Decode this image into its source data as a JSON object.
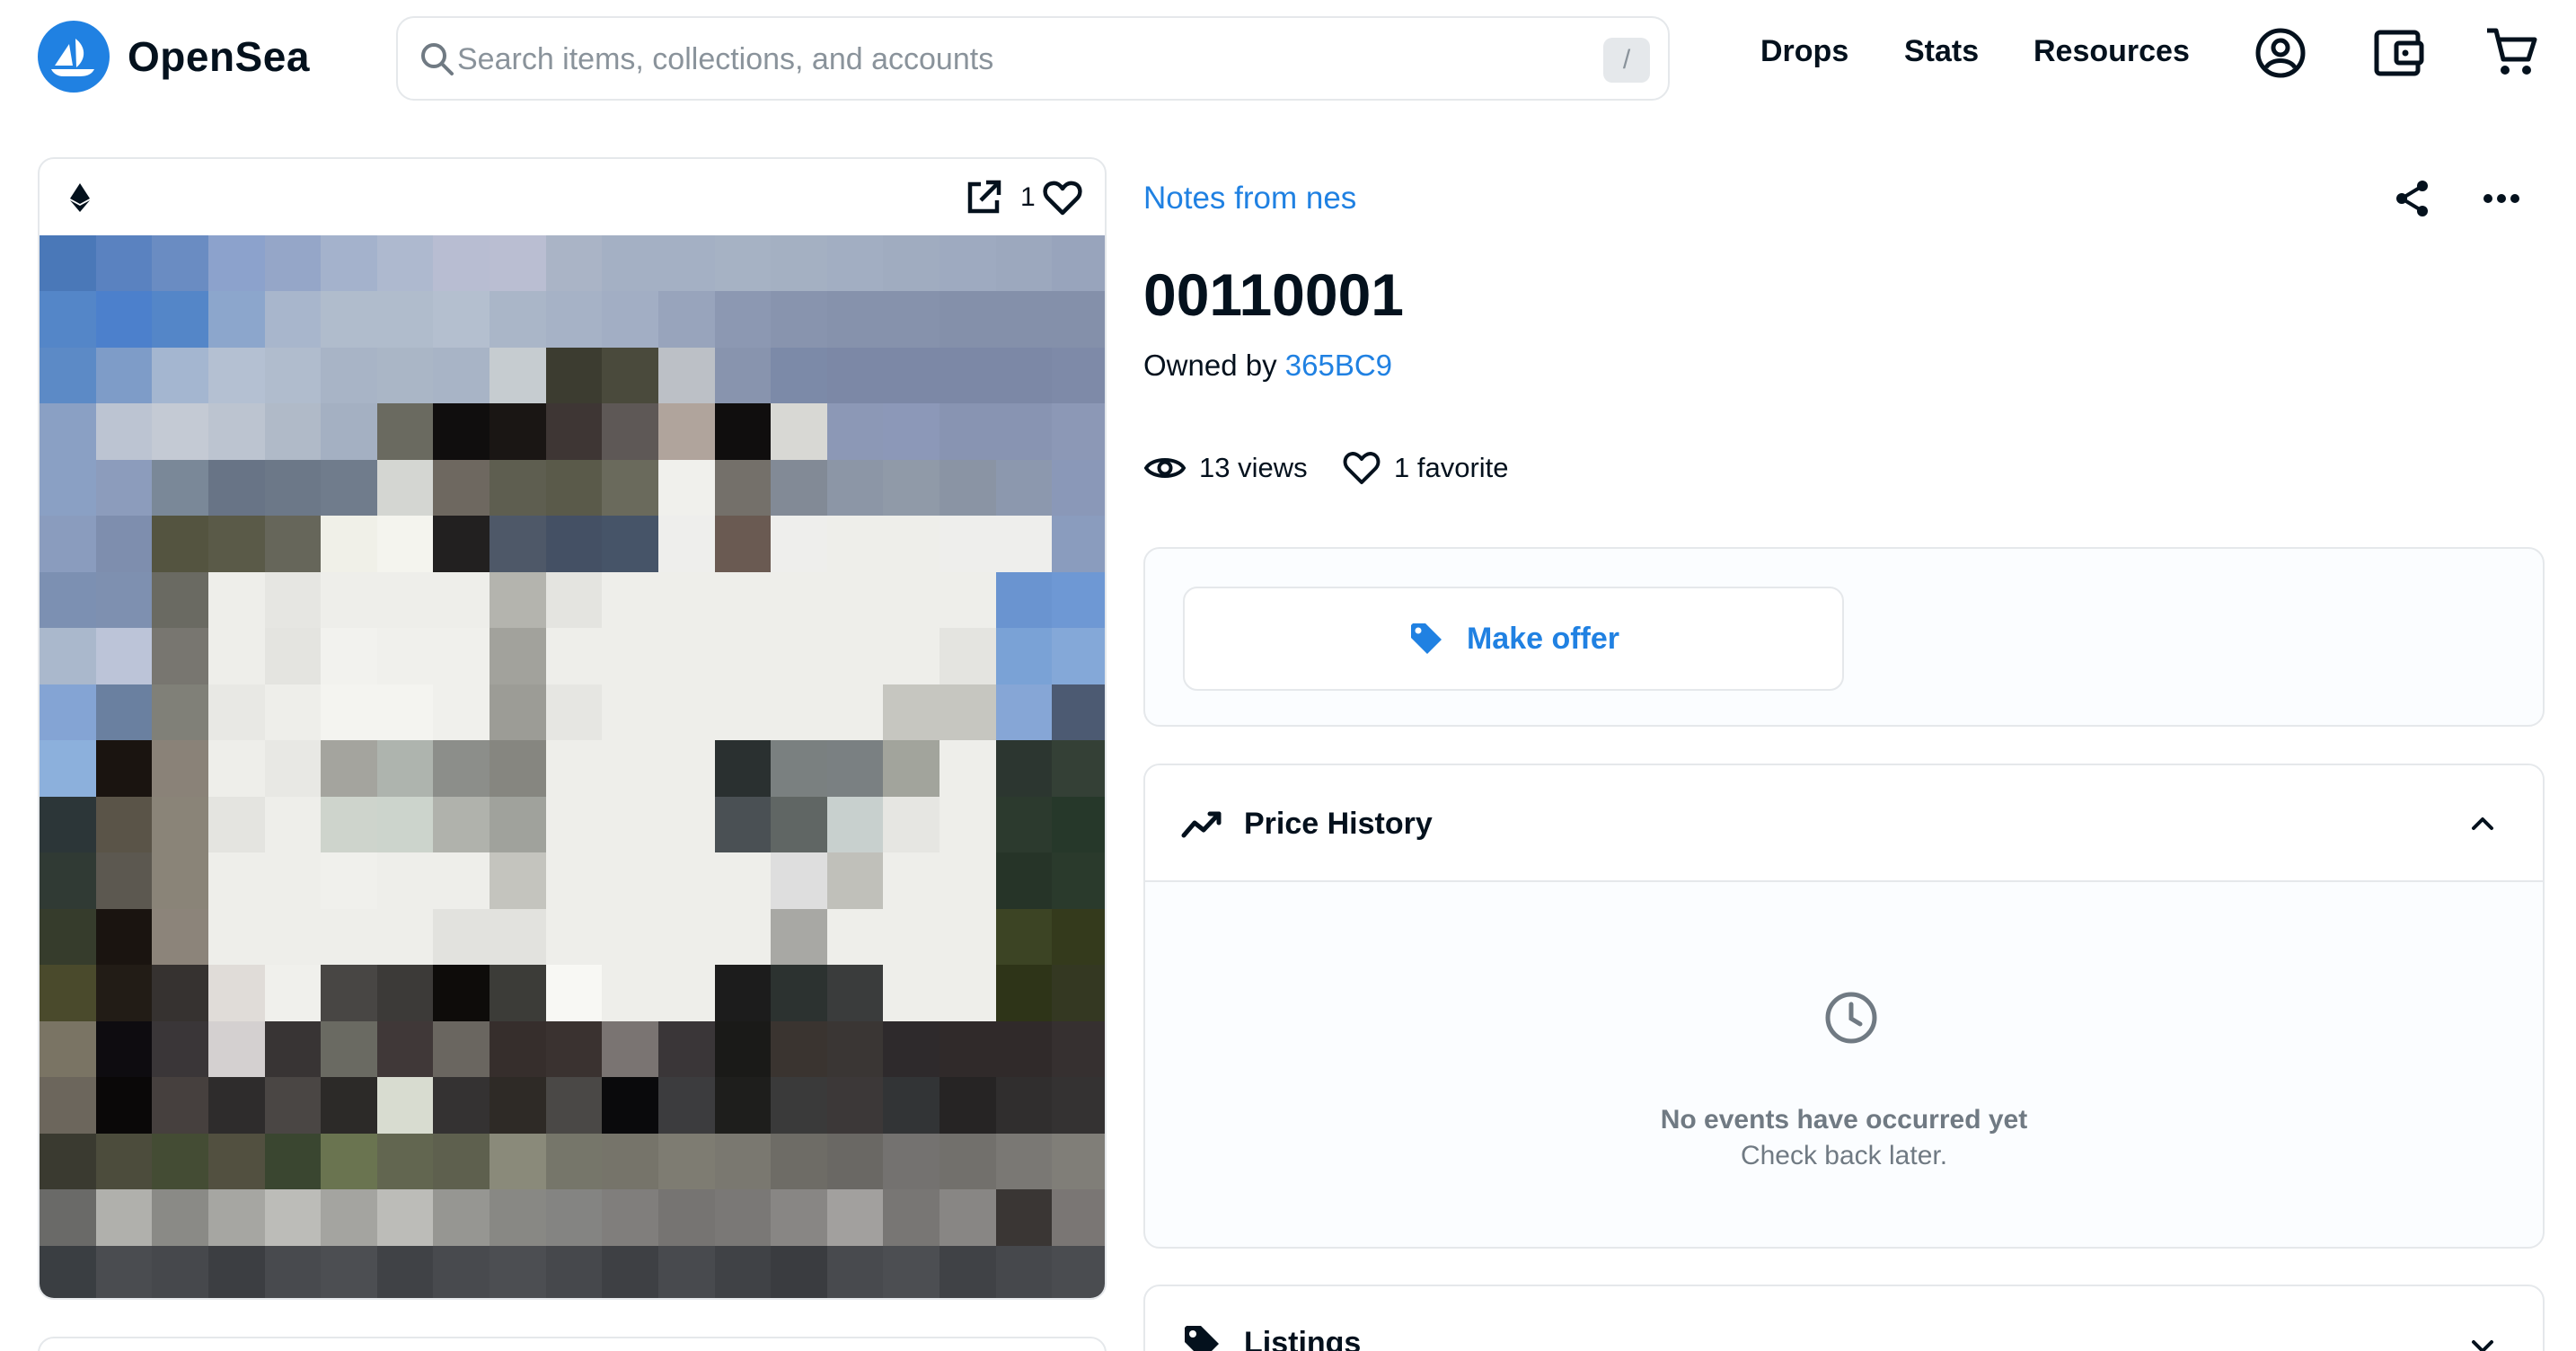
{
  "header": {
    "brand": "OpenSea",
    "search_placeholder": "Search items, collections, and accounts",
    "search_shortcut": "/",
    "nav": [
      "Drops",
      "Stats",
      "Resources"
    ],
    "icons": [
      "account-circle-icon",
      "wallet-icon",
      "cart-icon"
    ]
  },
  "item": {
    "collection": "Notes from nes",
    "title": "00110001",
    "owned_by_label": "Owned by",
    "owner": "365BC9",
    "favorite_count": "1",
    "views": "13 views",
    "favorites": "1 favorite"
  },
  "offer": {
    "button_label": "Make offer"
  },
  "price_history": {
    "title": "Price History",
    "empty_title": "No events have occurred yet",
    "empty_subtitle": "Check back later."
  },
  "listings": {
    "title": "Listings"
  },
  "colors": {
    "accent": "#2081e2",
    "text": "#04111d",
    "muted": "#707a83",
    "border": "#e5e8eb"
  },
  "pixel_art": [
    [
      "#4a78b8",
      "#5a82c0",
      "#6a8cc2",
      "#8ca2cc",
      "#95a6c8",
      "#a4b2cc",
      "#aeb9cf",
      "#b8bdd2",
      "#babed2",
      "#aab4c6",
      "#a4b0c4",
      "#a4b0c4",
      "#a6b2c4",
      "#a4b0c2",
      "#a2aec2",
      "#a0acc0",
      "#9eaac0",
      "#9ca8be",
      "#98a4bc"
    ],
    [
      "#5486c8",
      "#4c80cc",
      "#5486c8",
      "#8ca6cc",
      "#a8b6cc",
      "#b0bccc",
      "#b0bccc",
      "#b4bfcf",
      "#aab6c8",
      "#a6b2c6",
      "#a2aec4",
      "#98a4bc",
      "#8c98b2",
      "#8894ae",
      "#8692ac",
      "#8692ac",
      "#8490aa",
      "#8490aa",
      "#8490aa"
    ],
    [
      "#5c8ac6",
      "#7e9cc8",
      "#a4b6d0",
      "#b4c0d2",
      "#b0bccd",
      "#a8b4c6",
      "#aab6c6",
      "#a8b4c6",
      "#c6ccd0",
      "#3c3c30",
      "#4a4a3c",
      "#bcc0c6",
      "#8894ae",
      "#7c8aa8",
      "#7c88a6",
      "#7c88a6",
      "#7c88a6",
      "#7c88a6",
      "#7e8aa8"
    ],
    [
      "#8aa0c4",
      "#bcc4d2",
      "#c4cad4",
      "#bcc4d0",
      "#b0bac8",
      "#a4b0c2",
      "#6a6a60",
      "#100e0e",
      "#1a1614",
      "#3e3634",
      "#5e5856",
      "#b0a49c",
      "#100e0e",
      "#d8d8d4",
      "#8c98b6",
      "#8c98b8",
      "#8894b2",
      "#8894b2",
      "#8c98b6"
    ],
    [
      "#8aa0c4",
      "#8c9cbc",
      "#7a8898",
      "#687486",
      "#6c7888",
      "#707c8c",
      "#d4d6d2",
      "#6e6860",
      "#5e5e50",
      "#5a5a4a",
      "#6a6a5c",
      "#f0f0ec",
      "#74706a",
      "#828a96",
      "#8c96a6",
      "#909aa8",
      "#8a94a4",
      "#8c98ae",
      "#8a98b8"
    ],
    [
      "#8a9cbe",
      "#7e8eae",
      "#545440",
      "#5a5a48",
      "#66665a",
      "#f0f0e8",
      "#f4f4ee",
      "#222020",
      "#4e5868",
      "#445064",
      "#465468",
      "#eeeeec",
      "#6a5a52",
      "#eeeeec",
      "#eeeeea",
      "#eeeeea",
      "#eeeeec",
      "#eeeeec",
      "#8a9cbe"
    ],
    [
      "#7c90b2",
      "#7e90b0",
      "#6a6a62",
      "#eeeeea",
      "#e6e6e2",
      "#eeeeea",
      "#eeeeea",
      "#eeeeea",
      "#b4b4ae",
      "#e4e4e0",
      "#eeeeea",
      "#eeeeea",
      "#eeeeea",
      "#eeeeea",
      "#eeeeea",
      "#eeeeea",
      "#eeeeea",
      "#6a94d0",
      "#6e98d4"
    ],
    [
      "#aab8cc",
      "#bcc4d8",
      "#787670",
      "#eeeeea",
      "#e4e4e0",
      "#f2f2ee",
      "#f0f0ec",
      "#f0f0ec",
      "#a2a29c",
      "#eeeeea",
      "#eeeeea",
      "#eeeeea",
      "#eeeeea",
      "#eeeeea",
      "#eeeeea",
      "#eeeeea",
      "#e4e4e0",
      "#7aa2d6",
      "#84a8d8"
    ],
    [
      "#84a4d4",
      "#6a80a0",
      "#808078",
      "#e8e8e4",
      "#eeeeea",
      "#f4f4f0",
      "#f4f4f0",
      "#f0f0ec",
      "#9c9c96",
      "#e6e6e2",
      "#eeeeea",
      "#eeeeea",
      "#eeeeea",
      "#eeeeea",
      "#eeeeea",
      "#c6c6c0",
      "#c6c6c0",
      "#86a6d6",
      "#4c5a72"
    ],
    [
      "#8cb0dc",
      "#1a1410",
      "#8a8278",
      "#eeeeea",
      "#e8e8e4",
      "#a4a49e",
      "#aeb4ae",
      "#8c8e8a",
      "#868680",
      "#eeeeea",
      "#eeeeea",
      "#eeeeea",
      "#2a3030",
      "#7a8080",
      "#7a8082",
      "#a2a49c",
      "#eeeeea",
      "#2c3630",
      "#344036"
    ],
    [
      "#2c3638",
      "#5a5448",
      "#8a8478",
      "#e4e4e0",
      "#eeeeea",
      "#ced4cc",
      "#ccd4cc",
      "#b0b2ac",
      "#a0a29c",
      "#eeeeea",
      "#eeeeea",
      "#eeeeea",
      "#4a5054",
      "#606664",
      "#c8d0ce",
      "#e6e6e2",
      "#eeeeea",
      "#2c3a2e",
      "#26382a"
    ],
    [
      "#303a34",
      "#5c5850",
      "#8a8478",
      "#eeeeea",
      "#eeeeea",
      "#f0f0ec",
      "#eeeeea",
      "#eeeeea",
      "#c4c4be",
      "#eeeeea",
      "#eeeeea",
      "#eeeeea",
      "#eeeeea",
      "#dedede",
      "#c0c0ba",
      "#eeeeea",
      "#eeeeea",
      "#263428",
      "#2a3a2c"
    ],
    [
      "#363c2c",
      "#1a1410",
      "#8c847a",
      "#eeeeea",
      "#eeeeea",
      "#eeeeea",
      "#eeeeea",
      "#e2e2de",
      "#e2e2de",
      "#eeeeea",
      "#eeeeea",
      "#eeeeea",
      "#eeeeea",
      "#a8a8a4",
      "#eeeeea",
      "#eeeeea",
      "#eeeeea",
      "#3c4424",
      "#343a1c"
    ],
    [
      "#4a4a2c",
      "#221c16",
      "#363230",
      "#e0dcd8",
      "#f0f0ec",
      "#484644",
      "#3c3a38",
      "#0e0c0a",
      "#3c3c38",
      "#f8f8f4",
      "#eeeeea",
      "#eeeeea",
      "#1c1c1c",
      "#2c3230",
      "#3a3c3c",
      "#eeeeea",
      "#eeeeea",
      "#2e3418",
      "#343822"
    ],
    [
      "#7a7464",
      "#0e0c10",
      "#3a3638",
      "#d4d0d0",
      "#383434",
      "#6a6a62",
      "#403838",
      "#6a6660",
      "#362e2c",
      "#3a3230",
      "#7a7472",
      "#3a3638",
      "#1a1a18",
      "#3a3430",
      "#3a3634",
      "#2e2a2c",
      "#302a2a",
      "#302a2a",
      "#363030"
    ],
    [
      "#6c665c",
      "#0a0808",
      "#46403e",
      "#2e2c2c",
      "#4a4644",
      "#2c2a28",
      "#d8dcd0",
      "#343232",
      "#2e2a26",
      "#4a4846",
      "#0a0a0c",
      "#3c3c3e",
      "#1e1e1c",
      "#3a3a3a",
      "#3c3838",
      "#323436",
      "#262424",
      "#302e2e",
      "#343232"
    ],
    [
      "#3a3a30",
      "#4c4c3c",
      "#444c34",
      "#525040",
      "#3a4630",
      "#6a7450",
      "#626650",
      "#5e604e",
      "#8a8a7a",
      "#76766a",
      "#76746a",
      "#7e7c72",
      "#7a7870",
      "#6e6c66",
      "#6a6864",
      "#747270",
      "#72706c",
      "#7a7874",
      "#807e78"
    ],
    [
      "#6a6a68",
      "#b0b0ac",
      "#8a8a86",
      "#a6a6a2",
      "#bcbcb8",
      "#a4a4a0",
      "#bcbcb8",
      "#969692",
      "#888884",
      "#848482",
      "#807e7c",
      "#767472",
      "#7a7876",
      "#888684",
      "#a2a09e",
      "#787674",
      "#888684",
      "#3a3634",
      "#7a7674"
    ],
    [
      "#3a3e42",
      "#4a4c50",
      "#46484c",
      "#3c3e42",
      "#484a4e",
      "#4c4e52",
      "#404246",
      "#484a4e",
      "#4c4e52",
      "#46484c",
      "#3e4044",
      "#484a4e",
      "#404246",
      "#3a3c40",
      "#484a4e",
      "#4c4e52",
      "#404246",
      "#46484c",
      "#4a4c50"
    ]
  ]
}
